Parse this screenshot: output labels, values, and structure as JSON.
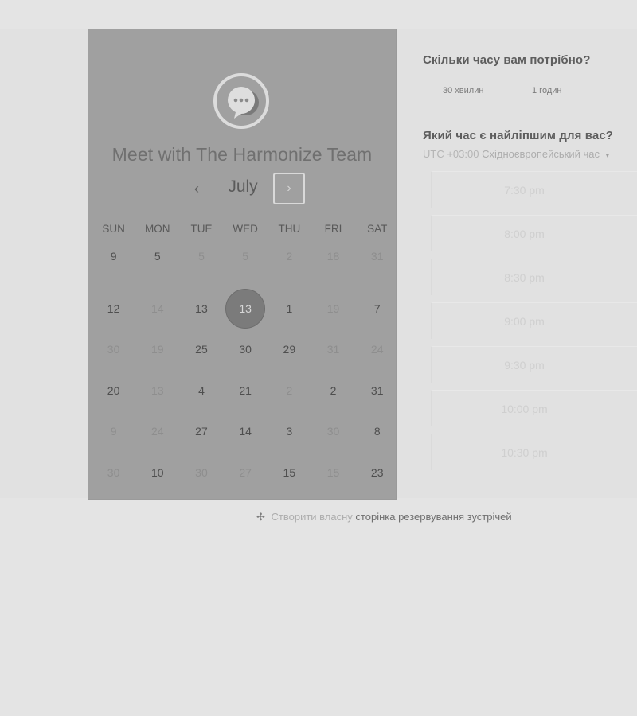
{
  "left_panel": {
    "title": "Meet with The Harmonize Team",
    "avatar_icon": "chat-bubble-icon",
    "month": "July",
    "prev_icon": "‹",
    "next_icon": "›",
    "weekdays": [
      "SUN",
      "MON",
      "TUE",
      "WED",
      "THU",
      "FRI",
      "SAT"
    ],
    "weeks": [
      [
        {
          "d": "9",
          "s": "available"
        },
        {
          "d": "5",
          "s": "available"
        },
        {
          "d": "5",
          "s": "unavailable"
        },
        {
          "d": "5",
          "s": "unavailable"
        },
        {
          "d": "2",
          "s": "unavailable"
        },
        {
          "d": "18",
          "s": "unavailable"
        },
        {
          "d": "31",
          "s": "unavailable"
        }
      ],
      [
        {
          "d": "12",
          "s": "available"
        },
        {
          "d": "14",
          "s": "unavailable"
        },
        {
          "d": "13",
          "s": "available"
        },
        {
          "d": "13",
          "s": "selected"
        },
        {
          "d": "1",
          "s": "available"
        },
        {
          "d": "19",
          "s": "unavailable"
        },
        {
          "d": "7",
          "s": "available"
        }
      ],
      [
        {
          "d": "30",
          "s": "unavailable"
        },
        {
          "d": "19",
          "s": "unavailable"
        },
        {
          "d": "25",
          "s": "available"
        },
        {
          "d": "30",
          "s": "available"
        },
        {
          "d": "29",
          "s": "available"
        },
        {
          "d": "31",
          "s": "unavailable"
        },
        {
          "d": "24",
          "s": "unavailable"
        }
      ],
      [
        {
          "d": "20",
          "s": "available"
        },
        {
          "d": "13",
          "s": "unavailable"
        },
        {
          "d": "4",
          "s": "available"
        },
        {
          "d": "21",
          "s": "available"
        },
        {
          "d": "2",
          "s": "unavailable"
        },
        {
          "d": "2",
          "s": "available"
        },
        {
          "d": "31",
          "s": "available"
        }
      ],
      [
        {
          "d": "9",
          "s": "unavailable"
        },
        {
          "d": "24",
          "s": "unavailable"
        },
        {
          "d": "27",
          "s": "available"
        },
        {
          "d": "14",
          "s": "available"
        },
        {
          "d": "3",
          "s": "available"
        },
        {
          "d": "30",
          "s": "unavailable"
        },
        {
          "d": "8",
          "s": "available"
        }
      ],
      [
        {
          "d": "30",
          "s": "unavailable"
        },
        {
          "d": "10",
          "s": "available"
        },
        {
          "d": "30",
          "s": "unavailable"
        },
        {
          "d": "27",
          "s": "unavailable"
        },
        {
          "d": "15",
          "s": "available"
        },
        {
          "d": "15",
          "s": "unavailable"
        },
        {
          "d": "23",
          "s": "available"
        }
      ]
    ]
  },
  "duration": {
    "question": "Скільки часу вам потрібно?",
    "options": [
      "30 хвилин",
      "1 годин"
    ]
  },
  "time": {
    "question": "Який час є найліпшим для вас?",
    "timezone_offset": "UTC +03:00",
    "timezone_name": "Східноєвропейський час",
    "caret_icon": "▾",
    "slots": [
      "7:30 pm",
      "8:00 pm",
      "8:30 pm",
      "9:00 pm",
      "9:30 pm",
      "10:00 pm",
      "10:30 pm"
    ]
  },
  "footer": {
    "logo_icon": "hubspot-sprocket-icon",
    "logo_glyph": "✣",
    "text_part1": "Створити власну",
    "text_part2": "сторінка резервування зустрічей"
  },
  "colors": {
    "panel": "#a0a0a0",
    "selected_day": "#7b7b7b",
    "background": "#e4e4e4"
  }
}
